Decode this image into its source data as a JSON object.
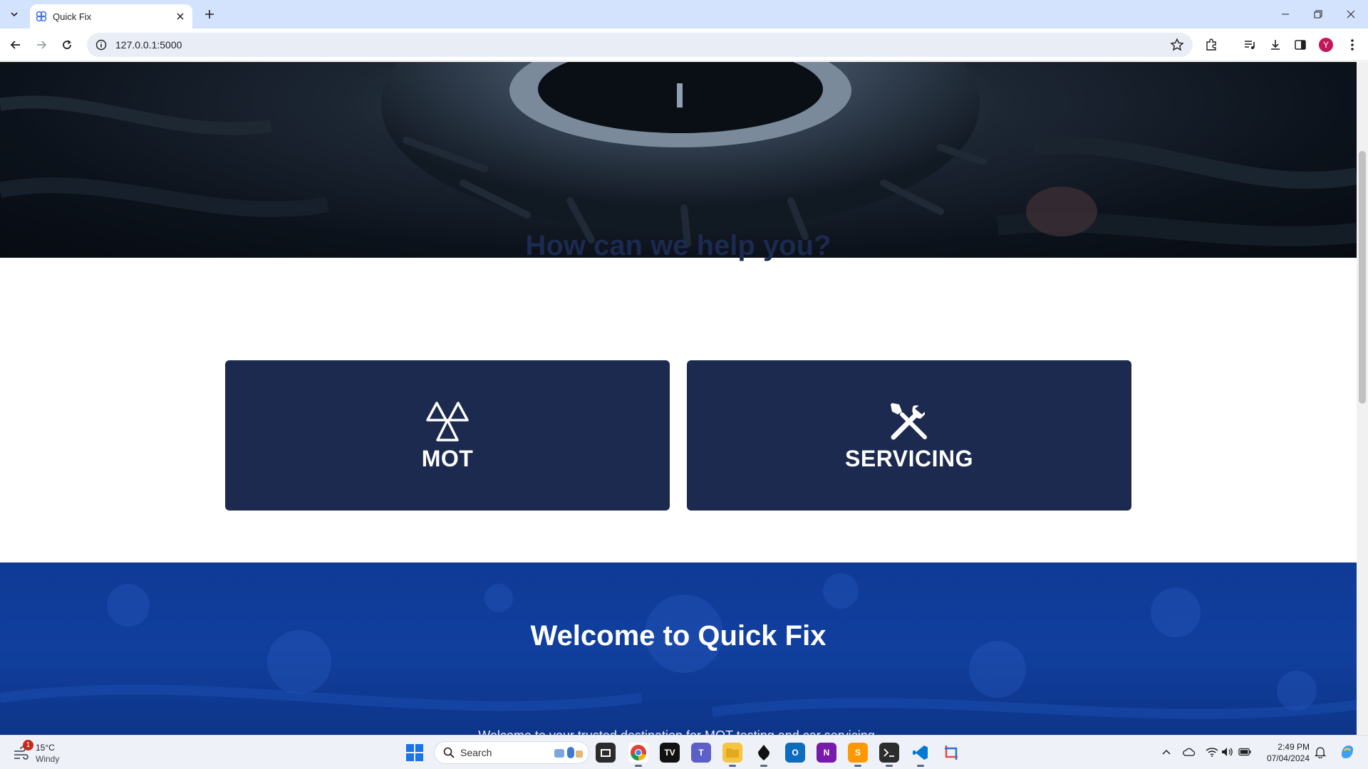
{
  "browser": {
    "tab_title": "Quick Fix",
    "url": "127.0.0.1:5000",
    "profile_initial": "Y"
  },
  "page": {
    "help_title": "How can we help you?",
    "services": [
      {
        "label": "MOT",
        "icon": "mot-triangles-icon"
      },
      {
        "label": "SERVICING",
        "icon": "wrench-screwdriver-icon"
      }
    ],
    "welcome_title": "Welcome to Quick Fix",
    "welcome_text": "Welcome to your trusted destination for MOT testing and car servicing."
  },
  "taskbar": {
    "weather_temp": "15°C",
    "weather_condition": "Windy",
    "weather_badge": "1",
    "search_placeholder": "Search",
    "clock_time": "2:49 PM",
    "clock_date": "07/04/2024",
    "apps": [
      "Chrome",
      "TV",
      "Teams",
      "File Explorer",
      "Inkscape",
      "Outlook",
      "OneNote",
      "Sublime",
      "Terminal",
      "VS Code",
      "Snipping Tool"
    ]
  },
  "colors": {
    "navy": "#1b2a4e",
    "welcome_blue": "#113f9e",
    "tabstrip": "#d3e3fd"
  }
}
